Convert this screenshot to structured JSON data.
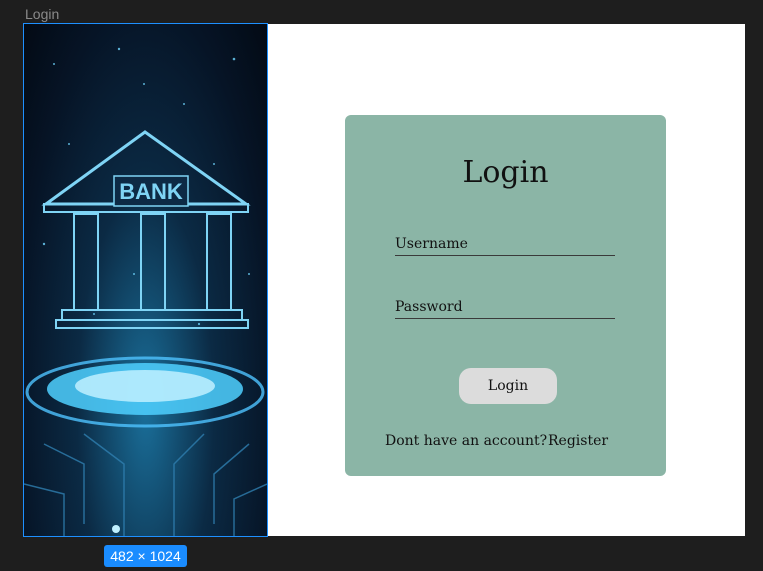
{
  "frame": {
    "name": "Login",
    "size_badge": "482 × 1024"
  },
  "left_image": {
    "sign_text": "BANK"
  },
  "login_card": {
    "title": "Login",
    "username_placeholder": "Username",
    "password_placeholder": "Password",
    "login_button_label": "Login",
    "signup_prompt": "Dont have an account?",
    "register_link": "Register"
  },
  "colors": {
    "card_background": "#8bb5a6",
    "button_background": "#dcdcdc",
    "selection_blue": "#1a8cff",
    "canvas_background": "#1e1e1e"
  }
}
